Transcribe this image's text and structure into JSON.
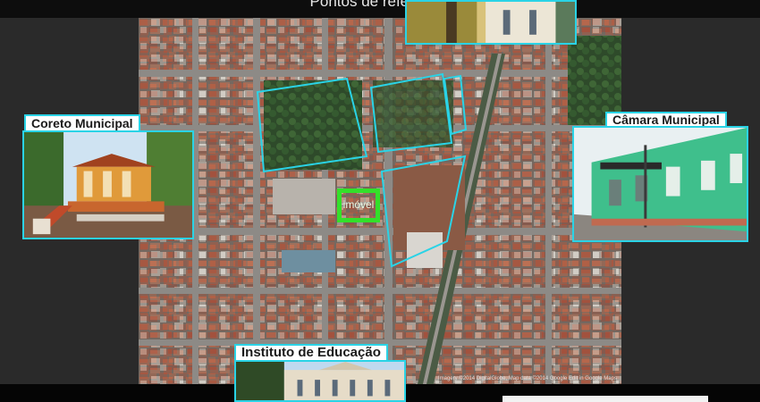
{
  "slide": {
    "title": "Pontos de referência"
  },
  "map": {
    "marker_label": "imóvel",
    "attribution": "Imagery ©2014 DigitalGlobe, Map data ©2014 Google   Edit in Google Maps",
    "highlight_color": "#2ad3e6",
    "marker_color": "#33e02a"
  },
  "landmarks": [
    {
      "label": "Coreto Municipal"
    },
    {
      "label": "Câmara Municipal"
    },
    {
      "label": "Instituto de Educação"
    }
  ]
}
